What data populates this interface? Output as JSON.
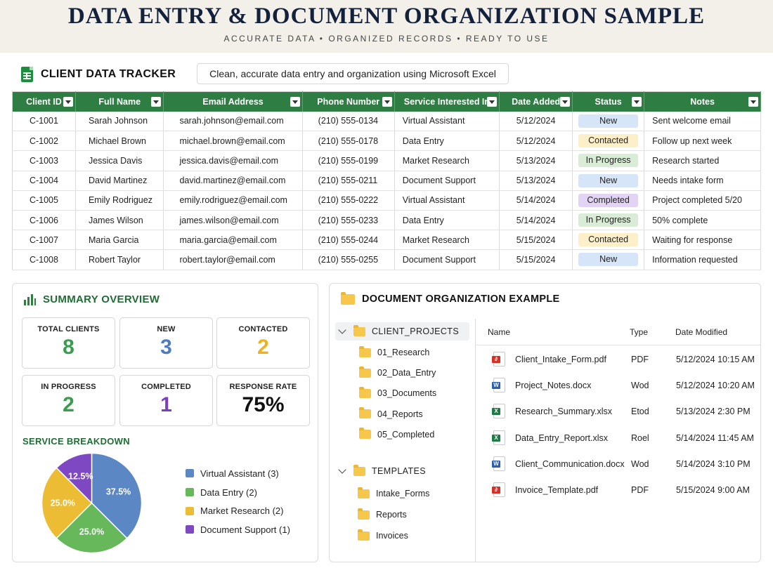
{
  "header": {
    "title": "DATA ENTRY & DOCUMENT ORGANIZATION SAMPLE",
    "subtitle": "ACCURATE DATA • ORGANIZED RECORDS • READY TO USE"
  },
  "tracker": {
    "title": "CLIENT DATA TRACKER",
    "tagline": "Clean, accurate data entry and organization using Microsoft Excel",
    "columns": [
      "Client ID",
      "Full Name",
      "Email Address",
      "Phone Number",
      "Service Interested In",
      "Date Added",
      "Status",
      "Notes"
    ],
    "rows": [
      {
        "id": "C-1001",
        "name": "Sarah Johnson",
        "email": "sarah.johnson@email.com",
        "phone": "(210) 555-0134",
        "service": "Virtual Assistant",
        "date": "5/12/2024",
        "status": "New",
        "notes": "Sent welcome email"
      },
      {
        "id": "C-1002",
        "name": "Michael Brown",
        "email": "michael.brown@email.com",
        "phone": "(210) 555-0178",
        "service": "Data Entry",
        "date": "5/12/2024",
        "status": "Contacted",
        "notes": "Follow up next week"
      },
      {
        "id": "C-1003",
        "name": "Jessica Davis",
        "email": "jessica.davis@email.com",
        "phone": "(210) 555-0199",
        "service": "Market Research",
        "date": "5/13/2024",
        "status": "In Progress",
        "notes": "Research started"
      },
      {
        "id": "C-1004",
        "name": "David Martinez",
        "email": "david.martinez@email.com",
        "phone": "(210) 555-0211",
        "service": "Document Support",
        "date": "5/13/2024",
        "status": "New",
        "notes": "Needs intake form"
      },
      {
        "id": "C-1005",
        "name": "Emily Rodriguez",
        "email": "emily.rodriguez@email.com",
        "phone": "(210) 555-0222",
        "service": "Virtual Assistant",
        "date": "5/14/2024",
        "status": "Completed",
        "notes": "Project completed 5/20"
      },
      {
        "id": "C-1006",
        "name": "James Wilson",
        "email": "james.wilson@email.com",
        "phone": "(210) 555-0233",
        "service": "Data Entry",
        "date": "5/14/2024",
        "status": "In Progress",
        "notes": "50% complete"
      },
      {
        "id": "C-1007",
        "name": "Maria Garcia",
        "email": "maria.garcia@email.com",
        "phone": "(210) 555-0244",
        "service": "Market Research",
        "date": "5/15/2024",
        "status": "Contacted",
        "notes": "Waiting for response"
      },
      {
        "id": "C-1008",
        "name": "Robert Taylor",
        "email": "robert.taylor@email.com",
        "phone": "(210) 555-0255",
        "service": "Document Support",
        "date": "5/15/2024",
        "status": "New",
        "notes": "Information requested"
      }
    ],
    "status_colors": {
      "New": "#d6e6f8",
      "Contacted": "#fdf0c8",
      "In Progress": "#d9ecd5",
      "Completed": "#e3d4f5"
    }
  },
  "summary": {
    "title": "SUMMARY OVERVIEW",
    "kpis": [
      {
        "label": "TOTAL CLIENTS",
        "value": "8",
        "color": "#3a9c4f"
      },
      {
        "label": "NEW",
        "value": "3",
        "color": "#4f7bc0"
      },
      {
        "label": "CONTACTED",
        "value": "2",
        "color": "#ecb21f"
      },
      {
        "label": "IN PROGRESS",
        "value": "2",
        "color": "#3a9c4f"
      },
      {
        "label": "COMPLETED",
        "value": "1",
        "color": "#7b3fbe"
      },
      {
        "label": "RESPONSE RATE",
        "value": "75%",
        "color": "#111111"
      }
    ],
    "breakdown_title": "SERVICE BREAKDOWN"
  },
  "chart_data": {
    "type": "pie",
    "title": "SERVICE BREAKDOWN",
    "categories": [
      "Virtual Assistant (3)",
      "Data Entry (2)",
      "Market Research (2)",
      "Document Support (1)"
    ],
    "values": [
      37.5,
      25.0,
      25.0,
      12.5
    ],
    "labels": [
      "37.5%",
      "25.0%",
      "25.0%",
      "12.5%"
    ],
    "colors": [
      "#5b87c5",
      "#66b85a",
      "#ecbd34",
      "#7e48c3"
    ],
    "legend": "right"
  },
  "documents": {
    "title": "DOCUMENT ORGANIZATION EXAMPLE",
    "tree": [
      {
        "label": "CLIENT_PROJECTS",
        "root": true,
        "children": [
          "01_Research",
          "02_Data_Entry",
          "03_Documents",
          "04_Reports",
          "05_Completed"
        ]
      },
      {
        "label": "TEMPLATES",
        "root": true,
        "children": [
          "Intake_Forms",
          "Reports",
          "Invoices"
        ]
      }
    ],
    "file_columns": [
      "Name",
      "Type",
      "Date Modified"
    ],
    "files": [
      {
        "name": "Client_Intake_Form.pdf",
        "type": "PDF",
        "modified": "5/12/2024 10:15 AM",
        "icon": "pdf-icon"
      },
      {
        "name": "Project_Notes.docx",
        "type": "Wod",
        "modified": "5/12/2024 10:20 AM",
        "icon": "word-icon"
      },
      {
        "name": "Research_Summary.xlsx",
        "type": "Etod",
        "modified": "5/13/2024 2:30 PM",
        "icon": "excel-icon"
      },
      {
        "name": "Data_Entry_Report.xlsx",
        "type": "Roel",
        "modified": "5/14/2024 11:45 AM",
        "icon": "excel-icon"
      },
      {
        "name": "Client_Communication.docx",
        "type": "Wod",
        "modified": "5/14/2024 3:10 PM",
        "icon": "word-icon"
      },
      {
        "name": "Invoice_Template.pdf",
        "type": "PDF",
        "modified": "5/15/2024 9:00 AM",
        "icon": "pdf-icon"
      }
    ]
  }
}
